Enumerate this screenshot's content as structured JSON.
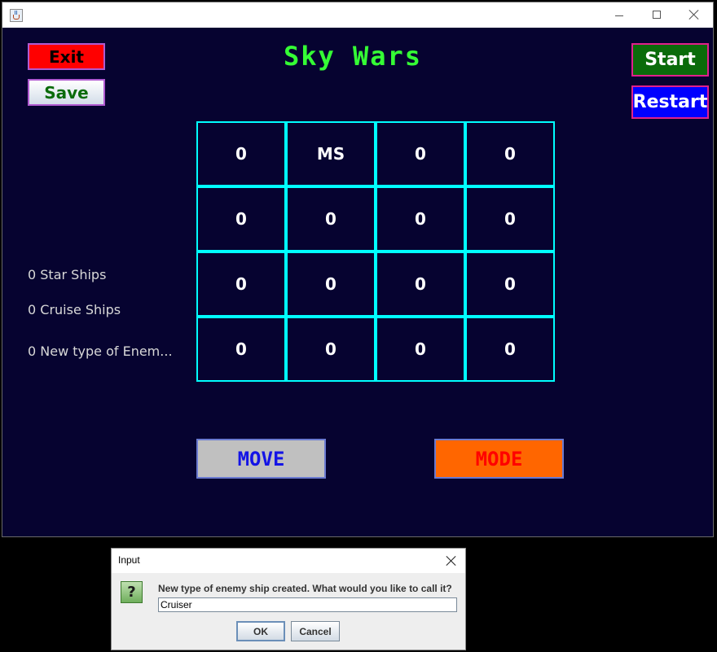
{
  "window": {
    "icon": "java-cup-icon"
  },
  "toolbar": {
    "exit_label": "Exit",
    "save_label": "Save",
    "start_label": "Start",
    "restart_label": "Restart"
  },
  "game": {
    "title": "Sky Wars",
    "grid": [
      [
        "0",
        "MS",
        "0",
        "0"
      ],
      [
        "0",
        "0",
        "0",
        "0"
      ],
      [
        "0",
        "0",
        "0",
        "0"
      ],
      [
        "0",
        "0",
        "0",
        "0"
      ]
    ],
    "move_label": "MOVE",
    "mode_label": "MODE"
  },
  "stats": {
    "star_ships": "0 Star Ships",
    "cruise_ships": "0 Cruise Ships",
    "new_type": "0 New type of Enem..."
  },
  "dialog": {
    "title": "Input",
    "message": "New type of enemy ship created. What would you like to call it?",
    "input_value": "Cruiser",
    "ok_label": "OK",
    "cancel_label": "Cancel",
    "icon": "question-icon"
  },
  "colors": {
    "background": "#060330",
    "grid_border": "#00ffff",
    "title": "#35ff35",
    "exit": "#ff0000",
    "start": "#0a6b0a",
    "restart": "#0000ff",
    "move": "#c0c0c0",
    "mode": "#ff6600"
  }
}
